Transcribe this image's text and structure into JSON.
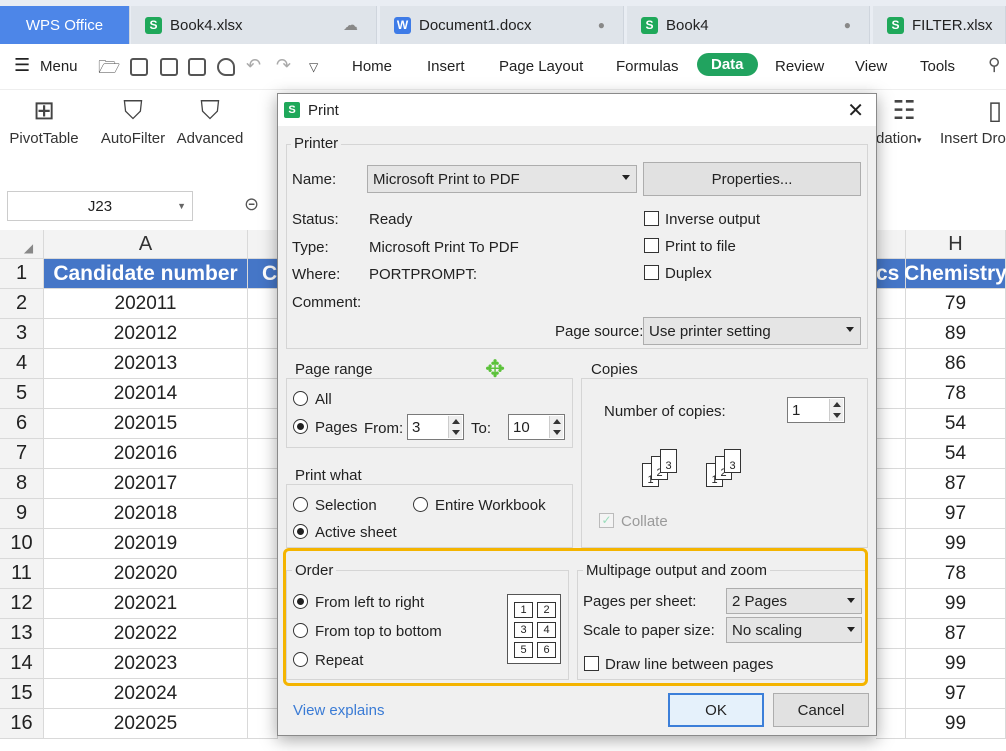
{
  "tabs": [
    {
      "label": "WPS Office",
      "icon": ""
    },
    {
      "label": "Book4.xlsx",
      "icon": "S",
      "right": "cloud"
    },
    {
      "label": "Document1.docx",
      "icon": "W",
      "right": "dot"
    },
    {
      "label": "Book4",
      "icon": "S",
      "right": "dot"
    },
    {
      "label": "FILTER.xlsx",
      "icon": "S",
      "right": ""
    }
  ],
  "menu": {
    "menu_label": "Menu",
    "items": [
      "Home",
      "Insert",
      "Page Layout",
      "Formulas",
      "Data",
      "Review",
      "View",
      "Tools"
    ]
  },
  "ribbon": {
    "pivot": "PivotTable",
    "autofilter": "AutoFilter",
    "advanced": "Advanced",
    "validation": "dation",
    "insert_drop": "Insert Dro"
  },
  "namebox": "J23",
  "sheet": {
    "columns": {
      "A": "A",
      "H": "H"
    },
    "header_row": {
      "a": "Candidate number",
      "c_partial": "C",
      "g_partial": "cs",
      "h": "Chemistry"
    },
    "rows": [
      {
        "n": "1"
      },
      {
        "n": "2",
        "a": "202011",
        "h": "79"
      },
      {
        "n": "3",
        "a": "202012",
        "h": "89"
      },
      {
        "n": "4",
        "a": "202013",
        "h": "86"
      },
      {
        "n": "5",
        "a": "202014",
        "h": "78"
      },
      {
        "n": "6",
        "a": "202015",
        "h": "54"
      },
      {
        "n": "7",
        "a": "202016",
        "h": "54"
      },
      {
        "n": "8",
        "a": "202017",
        "h": "87"
      },
      {
        "n": "9",
        "a": "202018",
        "h": "97"
      },
      {
        "n": "10",
        "a": "202019",
        "h": "99"
      },
      {
        "n": "11",
        "a": "202020",
        "h": "78"
      },
      {
        "n": "12",
        "a": "202021",
        "h": "99"
      },
      {
        "n": "13",
        "a": "202022",
        "h": "87"
      },
      {
        "n": "14",
        "a": "202023",
        "h": "99"
      },
      {
        "n": "15",
        "a": "202024",
        "h": "97"
      },
      {
        "n": "16",
        "a": "202025",
        "h": "99"
      }
    ]
  },
  "dialog": {
    "title": "Print",
    "printer": {
      "group": "Printer",
      "name_label": "Name:",
      "name_value": "Microsoft Print to PDF",
      "properties": "Properties...",
      "status_label": "Status:",
      "status_value": "Ready",
      "type_label": "Type:",
      "type_value": "Microsoft Print To PDF",
      "where_label": "Where:",
      "where_value": "PORTPROMPT:",
      "comment_label": "Comment:",
      "inverse": "Inverse output",
      "print_to_file": "Print to file",
      "duplex": "Duplex",
      "page_source_label": "Page source:",
      "page_source_value": "Use printer setting"
    },
    "page_range": {
      "group": "Page range",
      "all": "All",
      "pages": "Pages",
      "from_label": "From:",
      "from_value": "3",
      "to_label": "To:",
      "to_value": "10"
    },
    "copies": {
      "group": "Copies",
      "number_label": "Number of copies:",
      "number_value": "1",
      "collate": "Collate"
    },
    "print_what": {
      "group": "Print what",
      "selection": "Selection",
      "entire": "Entire Workbook",
      "active": "Active sheet"
    },
    "order": {
      "group": "Order",
      "ltr": "From left to right",
      "ttb": "From top to bottom",
      "repeat": "Repeat",
      "pages": [
        "1",
        "2",
        "3",
        "4",
        "5",
        "6"
      ]
    },
    "multipage": {
      "group": "Multipage output and zoom",
      "per_sheet_label": "Pages per sheet:",
      "per_sheet_value": "2 Pages",
      "scale_label": "Scale to paper size:",
      "scale_value": "No scaling",
      "draw_line": "Draw line between pages"
    },
    "view_explains": "View explains",
    "ok": "OK",
    "cancel": "Cancel"
  },
  "colors": {
    "accent": "#21a35f",
    "header_fill": "#4576c7",
    "highlight": "#f4b400",
    "link": "#3a7bd5"
  }
}
